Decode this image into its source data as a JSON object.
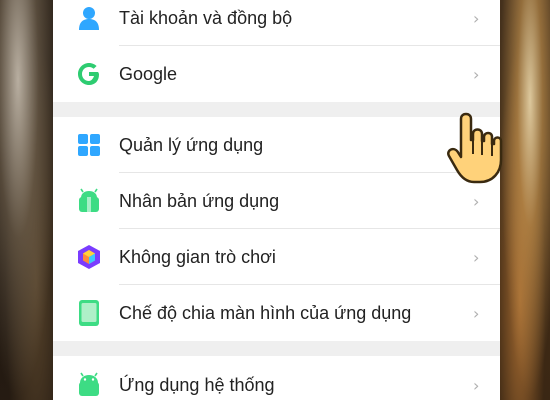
{
  "settings": {
    "items": [
      {
        "label": "Tài khoản và đồng bộ",
        "icon": "account-icon",
        "chevron": "›"
      },
      {
        "label": "Google",
        "icon": "google-icon",
        "chevron": "›"
      },
      {
        "label": "Quản lý ứng dụng",
        "icon": "app-grid-icon",
        "chevron": "›"
      },
      {
        "label": "Nhân bản ứng dụng",
        "icon": "android-clone-icon",
        "chevron": "›"
      },
      {
        "label": "Không gian trò chơi",
        "icon": "game-space-icon",
        "chevron": "›"
      },
      {
        "label": "Chế độ chia màn hình của ứng dụng",
        "icon": "split-screen-icon",
        "chevron": "›"
      },
      {
        "label": "Ứng dụng hệ thống",
        "icon": "android-system-icon",
        "chevron": "›"
      }
    ]
  },
  "colors": {
    "accent_blue": "#2fa7ff",
    "google_green": "#2ecc71",
    "android_green": "#3ddc84",
    "game_purple": "#7a3cff",
    "cursor_yellow": "#ffd27a"
  }
}
